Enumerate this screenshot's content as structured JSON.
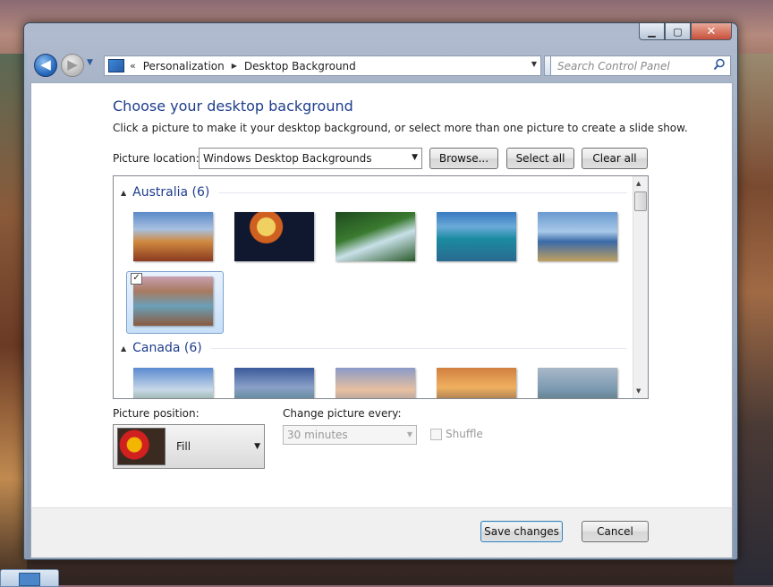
{
  "window": {
    "caption_buttons": {
      "minimize_icon": "minimize-icon",
      "maximize_icon": "maximize-icon",
      "close_icon": "close-icon"
    }
  },
  "nav": {
    "breadcrumb": [
      "Personalization",
      "Desktop Background"
    ],
    "search_placeholder": "Search Control Panel"
  },
  "page": {
    "title": "Choose your desktop background",
    "description": "Click a picture to make it your desktop background, or select more than one picture to create a slide show.",
    "location_label": "Picture location:",
    "location_value": "Windows Desktop Backgrounds",
    "browse_label": "Browse...",
    "select_all_label": "Select all",
    "clear_all_label": "Clear all"
  },
  "gallery": {
    "groups": [
      {
        "name": "Australia (6)",
        "thumbnails": 6,
        "selected_index": 5
      },
      {
        "name": "Canada (6)",
        "thumbnails": 6
      }
    ]
  },
  "position": {
    "label": "Picture position:",
    "value": "Fill"
  },
  "slideshow": {
    "change_label": "Change picture every:",
    "interval_value": "30 minutes",
    "shuffle_label": "Shuffle",
    "shuffle_checked": false
  },
  "footer": {
    "save_label": "Save changes",
    "cancel_label": "Cancel"
  },
  "colors": {
    "heading": "#1e3d8c",
    "window_frame": "#9cb4d3",
    "selected_tile": "#c7dff8"
  }
}
